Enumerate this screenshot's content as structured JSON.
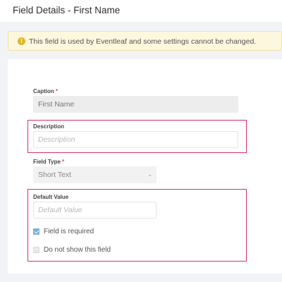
{
  "header": {
    "title": "Field Details - First Name"
  },
  "alert": {
    "icon": "info-icon",
    "message": "This field is used by Eventleaf and some settings cannot be changed."
  },
  "form": {
    "caption": {
      "label": "Caption",
      "required_mark": "*",
      "value": "First Name"
    },
    "description": {
      "label": "Description",
      "placeholder": "Description"
    },
    "field_type": {
      "label": "Field Type",
      "required_mark": "*",
      "selected": "Short Text",
      "icon": "chevron-down-icon"
    },
    "default_value": {
      "label": "Default Value",
      "placeholder": "Default Value"
    },
    "field_required": {
      "label": "Field is required",
      "checked": true
    },
    "do_not_show": {
      "label": "Do not show this field",
      "checked": false
    }
  },
  "colors": {
    "highlight": "#d9306a",
    "required_mark": "#e0455a",
    "alert_background": "#fdf7de",
    "checkbox_checked": "#7ab0dd"
  }
}
